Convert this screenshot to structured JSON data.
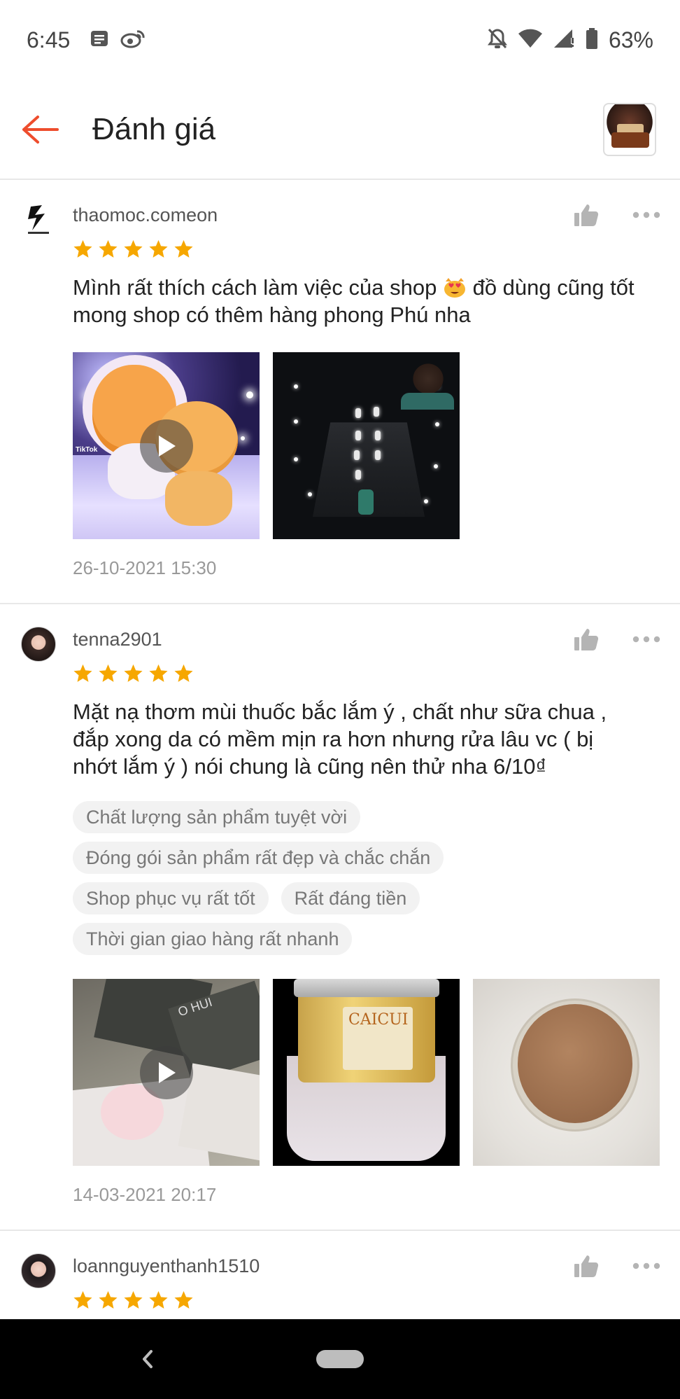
{
  "status_bar": {
    "time": "6:45",
    "battery": "63%",
    "icons_left": [
      "message-icon",
      "weibo-icon"
    ],
    "icons_right": [
      "mute-icon",
      "wifi-icon",
      "signal-icon",
      "battery-icon"
    ]
  },
  "header": {
    "title": "Đánh giá",
    "accent_color": "#ee4d2d"
  },
  "reviews": [
    {
      "username": "thaomoc.comeon",
      "rating": 5,
      "text_before_emoji": "Mình rất thích cách làm việc của shop ",
      "text_after_emoji": " đồ dùng cũng tốt mong shop có thêm hàng phong Phú nha",
      "emoji": "heart-eyes-cat-emoji",
      "media": [
        {
          "kind": "video",
          "badge": "TikTok"
        },
        {
          "kind": "image"
        }
      ],
      "date": "26-10-2021 15:30"
    },
    {
      "username": "tenna2901",
      "rating": 5,
      "text": "Mặt nạ thơm mùi thuốc bắc lắm ý , chất như sữa chua , đắp xong da có mềm mịn ra hơn nhưng rửa lâu vc ( bị nhớt lắm ý ) nói chung là cũng nên thử nha 6/10₫",
      "tags": [
        "Chất lượng sản phẩm tuyệt vời",
        "Đóng gói sản phẩm rất đẹp và chắc chắn",
        "Shop phục vụ rất tốt",
        "Rất đáng tiền",
        "Thời gian giao hàng rất nhanh"
      ],
      "media": [
        {
          "kind": "video",
          "badge": "O HUI"
        },
        {
          "kind": "image",
          "badge": "CAICUI"
        },
        {
          "kind": "image"
        }
      ],
      "date": "14-03-2021 20:17"
    },
    {
      "username": "loannguyenthanh1510",
      "rating": 5
    }
  ],
  "colors": {
    "star": "#f6a700",
    "icon_gray": "#b4b4b4",
    "tag_bg": "#f2f2f2",
    "divider": "#e8e8e8"
  }
}
